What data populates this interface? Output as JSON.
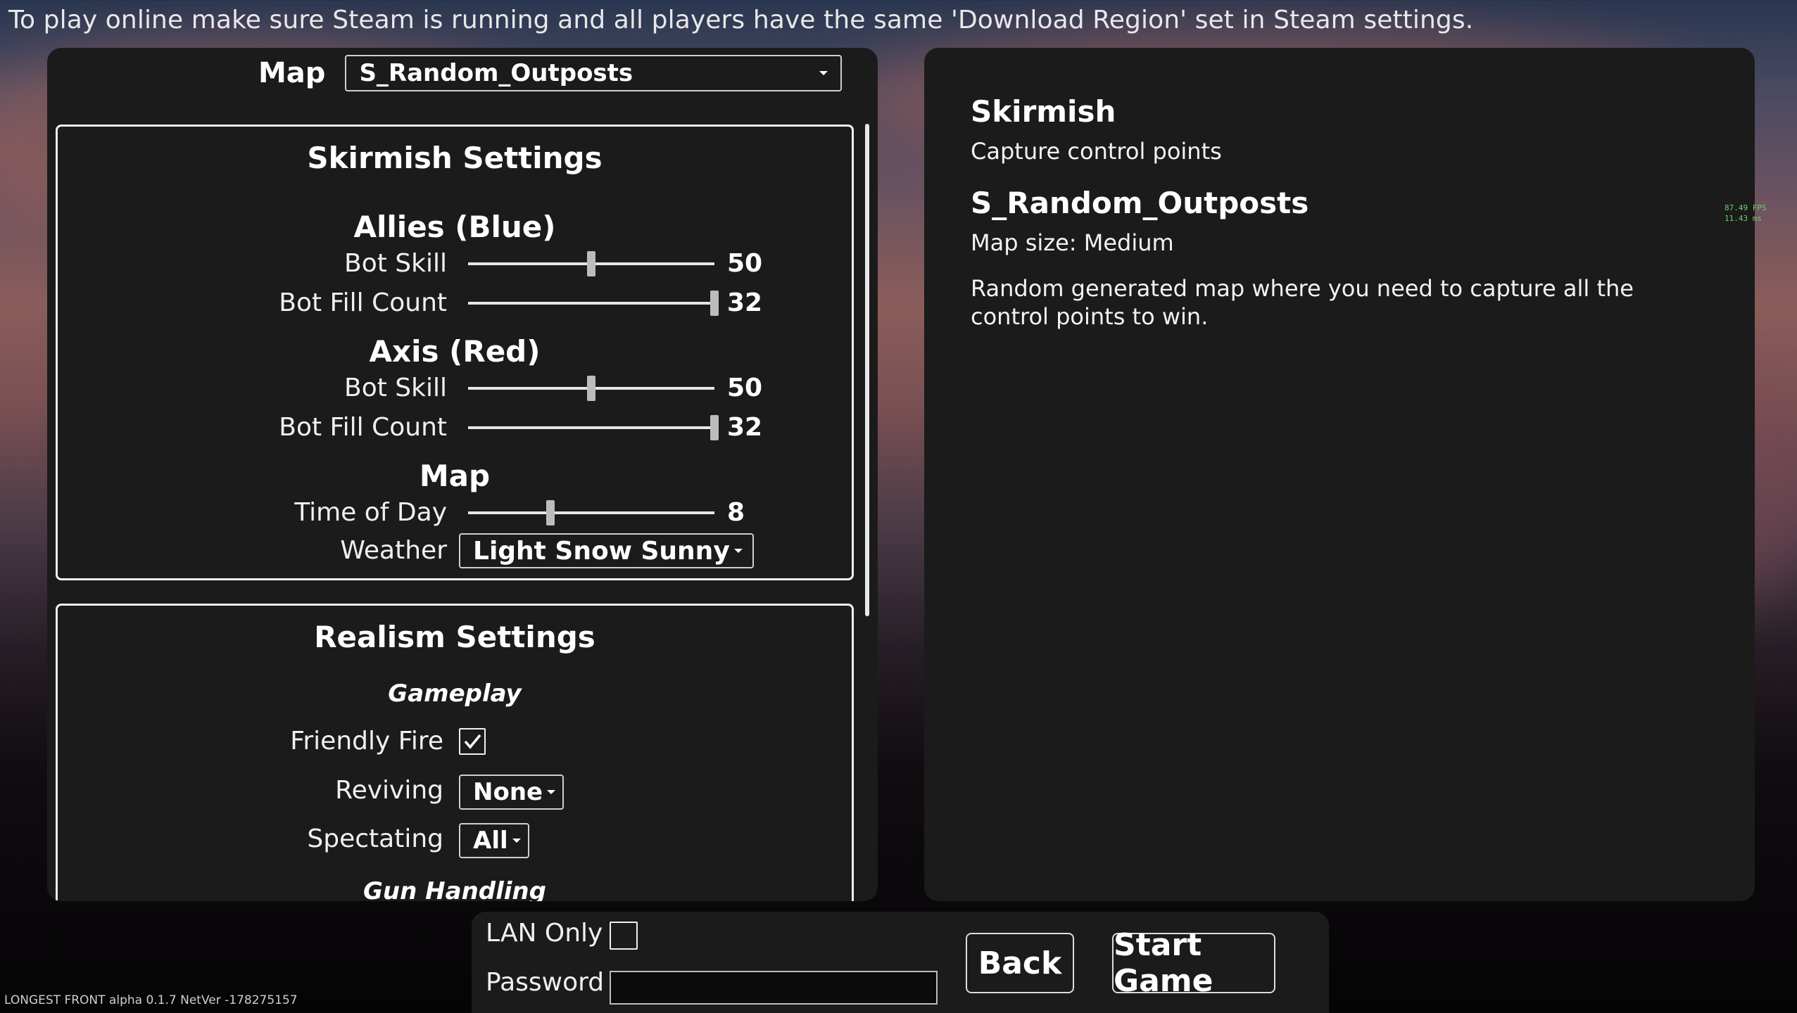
{
  "notice": "To play online make sure Steam is running and all players have the same 'Download Region' set in Steam settings.",
  "map_select": {
    "label": "Map",
    "value": "S_Random_Outposts"
  },
  "skirmish": {
    "title": "Skirmish Settings",
    "allies": {
      "title": "Allies (Blue)",
      "bot_skill": {
        "label": "Bot Skill",
        "value": 50,
        "fraction": 0.5
      },
      "bot_fill": {
        "label": "Bot Fill Count",
        "value": 32,
        "fraction": 1.0
      }
    },
    "axis": {
      "title": "Axis (Red)",
      "bot_skill": {
        "label": "Bot Skill",
        "value": 50,
        "fraction": 0.5
      },
      "bot_fill": {
        "label": "Bot Fill Count",
        "value": 32,
        "fraction": 1.0
      }
    },
    "map": {
      "title": "Map",
      "time_of_day": {
        "label": "Time of Day",
        "value": 8,
        "fraction": 0.333
      },
      "weather": {
        "label": "Weather",
        "value": "Light Snow Sunny"
      }
    }
  },
  "realism": {
    "title": "Realism Settings",
    "gameplay_title": "Gameplay",
    "friendly_fire": {
      "label": "Friendly Fire",
      "checked": true
    },
    "reviving": {
      "label": "Reviving",
      "value": "None"
    },
    "spectating": {
      "label": "Spectating",
      "value": "All"
    },
    "gun_handling_title": "Gun Handling"
  },
  "info": {
    "mode_title": "Skirmish",
    "mode_desc": "Capture control points",
    "map_title": "S_Random_Outposts",
    "map_size": "Map size: Medium",
    "map_desc": "Random generated map where you need to capture all the control points to win."
  },
  "perf": {
    "fps": "87.49 FPS",
    "ms": "11.43 ms"
  },
  "bottom": {
    "lan_label": "LAN Only",
    "lan_checked": false,
    "password_label": "Password",
    "password_value": "",
    "back_label": "Back",
    "start_label": "Start Game"
  },
  "version": "LONGEST FRONT alpha   0.1.7 NetVer -178275157",
  "colors": {
    "panel": "#1b1b1b",
    "border": "#f0f0f0",
    "fps_text": "#6fc96f"
  }
}
